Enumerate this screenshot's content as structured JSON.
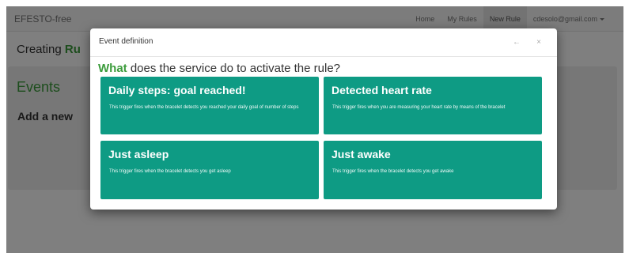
{
  "navbar": {
    "brand": "EFESTO-free",
    "links": [
      {
        "label": "Home"
      },
      {
        "label": "My Rules"
      },
      {
        "label": "New Rule"
      }
    ],
    "user_email": "cdesolo@gmail.com"
  },
  "page": {
    "title_prefix": "Creating ",
    "title_accent": "Ru",
    "events_title": "Events",
    "add_new_label": "Add a new"
  },
  "modal": {
    "title": "Event definition",
    "back_icon": "←",
    "close_icon": "×",
    "question_accent": "What",
    "question_rest": " does the service do to activate the rule?",
    "cards": [
      {
        "title": "Daily steps: goal reached!",
        "description": "This trigger fires when the bracelet detects you reached your daily goal of number of steps"
      },
      {
        "title": "Detected heart rate",
        "description": "This trigger fires when you are measuring your heart rate by means of the bracelet"
      },
      {
        "title": "Just asleep",
        "description": "This trigger fires when the bracelet detects you get asleep"
      },
      {
        "title": "Just awake",
        "description": "This trigger fires when the bracelet detects you get awake"
      }
    ]
  },
  "colors": {
    "card_bg": "#0e9b84",
    "accent_green": "#3c9c3c",
    "backdrop": "rgba(0,0,0,0.5)"
  }
}
